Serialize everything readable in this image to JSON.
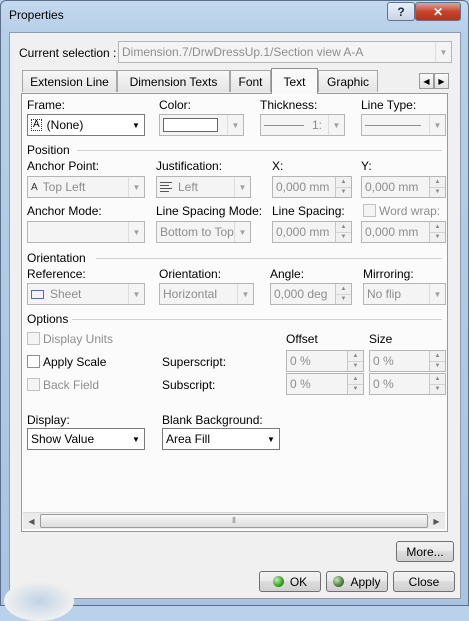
{
  "window": {
    "title": "Properties",
    "help_glyph": "?",
    "close_glyph": "✕"
  },
  "current_selection": {
    "label": "Current selection :",
    "value": "Dimension.7/DrwDressUp.1/Section view A-A"
  },
  "tabs": [
    "Extension Line",
    "Dimension Texts",
    "Font",
    "Text",
    "Graphic"
  ],
  "active_tab": "Text",
  "frame": {
    "frame_label": "Frame:",
    "frame_value": "(None)",
    "frame_glyph": "A",
    "color_label": "Color:",
    "thickness_label": "Thickness:",
    "thickness_value": "1:",
    "linetype_label": "Line Type:"
  },
  "position": {
    "title": "Position",
    "anchor_point_label": "Anchor Point:",
    "anchor_point_value": "Top Left",
    "anchor_glyph": "A",
    "justification_label": "Justification:",
    "justification_value": "Left",
    "x_label": "X:",
    "x_value": "0,000 mm",
    "y_label": "Y:",
    "y_value": "0,000 mm",
    "anchor_mode_label": "Anchor Mode:",
    "line_spacing_mode_label": "Line Spacing Mode:",
    "line_spacing_mode_value": "Bottom to Top",
    "line_spacing_label": "Line Spacing:",
    "line_spacing_value": "0,000 mm",
    "word_wrap_label": "Word wrap:",
    "word_wrap_value": "0,000 mm"
  },
  "orientation": {
    "title": "Orientation",
    "reference_label": "Reference:",
    "reference_value": "Sheet",
    "orientation_label": "Orientation:",
    "orientation_value": "Horizontal",
    "angle_label": "Angle:",
    "angle_value": "0,000 deg",
    "mirroring_label": "Mirroring:",
    "mirroring_value": "No flip"
  },
  "options": {
    "title": "Options",
    "display_units_label": "Display Units",
    "apply_scale_label": "Apply Scale",
    "back_field_label": "Back Field",
    "offset_header": "Offset",
    "size_header": "Size",
    "superscript_label": "Superscript:",
    "superscript_offset": "0 %",
    "superscript_size": "0 %",
    "subscript_label": "Subscript:",
    "subscript_offset": "0 %",
    "subscript_size": "0 %"
  },
  "display": {
    "label": "Display:",
    "value": "Show Value"
  },
  "blank_background": {
    "label": "Blank Background:",
    "value": "Area Fill"
  },
  "buttons": {
    "more": "More...",
    "ok": "OK",
    "apply": "Apply",
    "close": "Close"
  },
  "icons": {
    "dropdown": "▼",
    "spin_up": "▲",
    "spin_down": "▼",
    "tab_left": "◀",
    "tab_right": "▶",
    "scroll_left": "◀",
    "scroll_right": "▶",
    "grip": "⦀"
  }
}
